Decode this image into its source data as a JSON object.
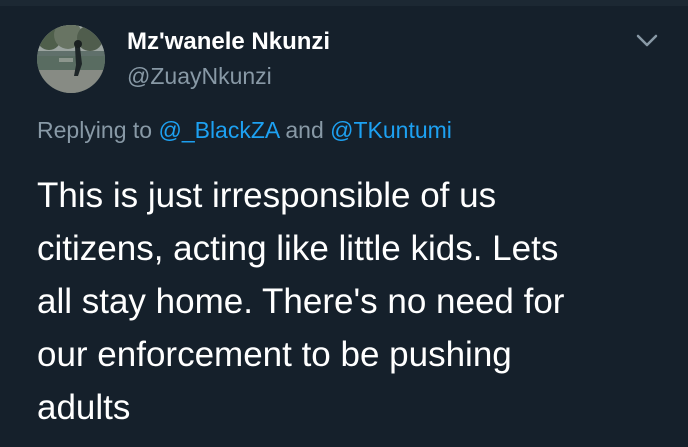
{
  "tweet": {
    "author": {
      "display_name": "Mz'wanele Nkunzi",
      "handle": "@ZuayNkunzi"
    },
    "reply_context": {
      "prefix": "Replying to",
      "mentions": [
        "@_BlackZA",
        "@TKuntumi"
      ],
      "conjunction": "and"
    },
    "text_lines": [
      "This is just irresponsible of us",
      "citizens, acting like little kids. Lets",
      "all stay home. There's no need for",
      "our enforcement to be pushing",
      "adults"
    ],
    "icons": {
      "menu": "chevron-down-icon",
      "avatar": "avatar-photo"
    }
  },
  "theme": {
    "background": "#15202b",
    "secondary_text": "#8899a6",
    "accent": "#1da1f2"
  }
}
